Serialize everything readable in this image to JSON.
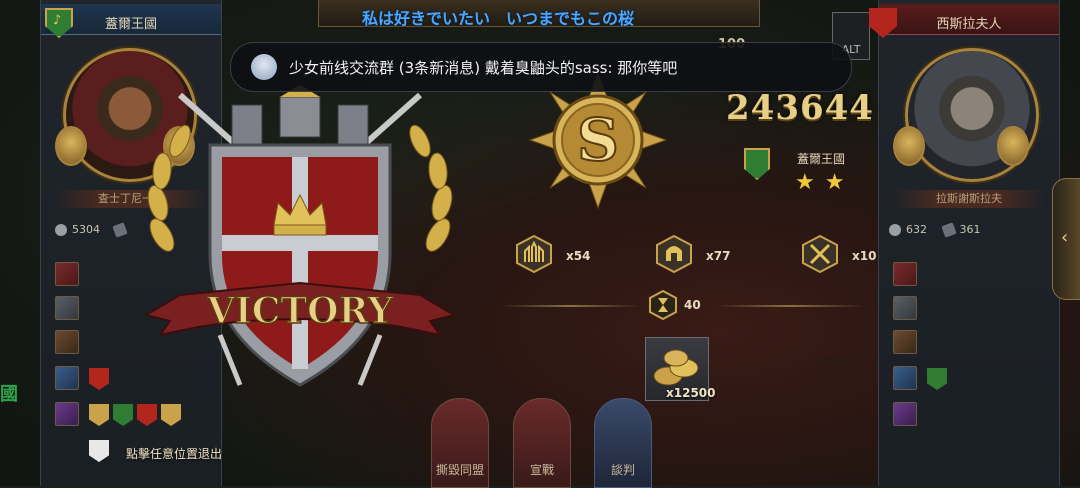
{
  "lyric": "私は好きでいたい　いつまでもこの桜",
  "notification": {
    "group": "少女前线交流群",
    "unread": "(3条新消息)",
    "message": "戴着臭鼬头的sass: 那你等吧"
  },
  "left_panel": {
    "title": "蓋爾王國",
    "ruler_name": "查士丁尼一世",
    "stat_a": "5304",
    "flags": [
      "#c9a24a",
      "#2e7d32",
      "#b3261e",
      "#c9a24a"
    ]
  },
  "right_panel": {
    "title": "西斯拉夫人",
    "ruler_name": "拉斯謝斯拉夫",
    "stat_a": "632",
    "stat_b": "361"
  },
  "victory_text": "VICTORY",
  "result": {
    "score": "243644",
    "country": "蓋爾王國",
    "stars": "★★",
    "star_count": 2,
    "resources": [
      {
        "icon": "castle-icon",
        "value": "x54"
      },
      {
        "icon": "helmet-icon",
        "value": "x77"
      },
      {
        "icon": "swords-icon",
        "value": "x10"
      }
    ],
    "hourglass_value": "40",
    "gold_reward": "x12500"
  },
  "actions": [
    {
      "icon": "handshake-icon",
      "label": "撕毀同盟"
    },
    {
      "icon": "crossed-swords-icon",
      "label": "宣戰"
    },
    {
      "icon": "coins-icon",
      "label": "談判"
    }
  ],
  "exit_hint": "點擊任意位置退出",
  "map_labels": {
    "left": "國",
    "right": "西斯"
  },
  "top_value": "100",
  "alt_label": "ALT",
  "colors": {
    "gold": "#e8cf86",
    "lyric": "#4aa8ff",
    "shield_red": "#8e1a1a"
  }
}
